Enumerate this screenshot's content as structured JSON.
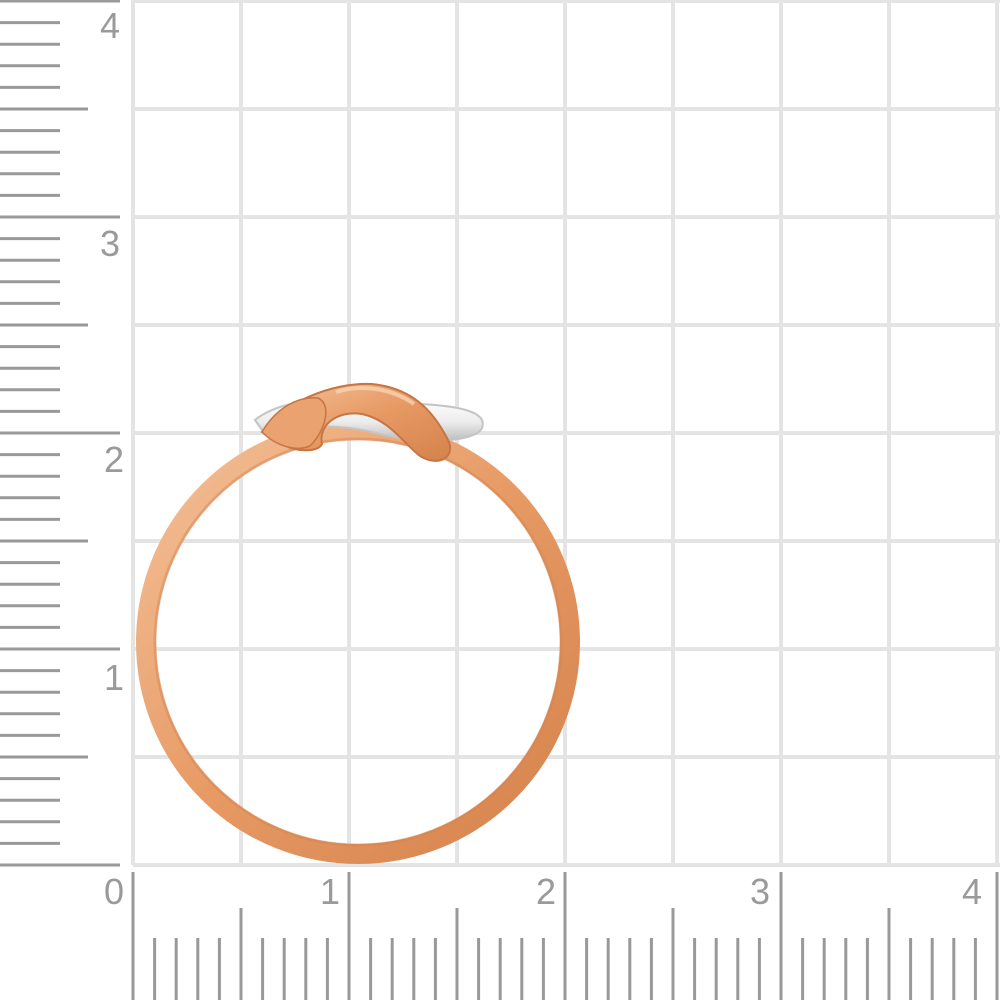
{
  "colors": {
    "background": "#ffffff",
    "grid": "#e4e4e4",
    "ruler": "#999999",
    "label": "#9a9a9a",
    "gold_light": "#f2b88e",
    "gold_mid": "#e79a64",
    "gold_dark": "#c77543",
    "silver_light": "#ffffff",
    "silver_mid": "#e8e8e8",
    "silver_dark": "#b9b9b9"
  },
  "ruler": {
    "unit": "cm",
    "x_labels": [
      "0",
      "1",
      "2",
      "3",
      "4"
    ],
    "y_labels": [
      "1",
      "2",
      "3",
      "4"
    ],
    "minor_per_major": 10
  },
  "product": {
    "type": "knot ring",
    "metals": [
      "red-gold",
      "white-gold"
    ]
  }
}
